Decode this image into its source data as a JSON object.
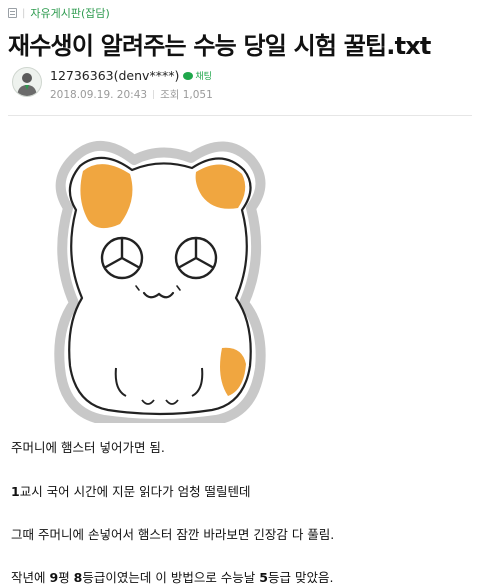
{
  "board": {
    "icon": "board-list-icon",
    "name": "자유게시판(잡담)"
  },
  "post": {
    "title": "재수생이 알려주는 수능 당일 시험 꿀팁.txt",
    "author": "12736363(denv****)",
    "chat_tag": "채팅",
    "date": "2018.09.19. 20:43",
    "views": "조회 1,051"
  },
  "content": {
    "sticker": "hamster-sticker-image",
    "paragraphs": [
      {
        "text": "주머니에 햄스터 넣어가면 됨."
      },
      {
        "bold": "1",
        "text": "교시 국어 시간에 지문 읽다가 엄청 떨릴텐데"
      },
      {
        "text": "그때 주머니에 손넣어서 햄스터 잠깐 바라보면 긴장감 다 풀림."
      },
      {
        "prefix": "작년에 ",
        "bold1": "9",
        "mid1": "평 ",
        "bold2": "8",
        "mid2": "등급이였는데 이 방법으로 수능날 ",
        "bold3": "5",
        "suffix": "등급 맞았음."
      }
    ]
  },
  "colors": {
    "accent": "#2e9b4f",
    "hamster_orange": "#f0a640",
    "sticker_outline": "#c8c8c8"
  }
}
